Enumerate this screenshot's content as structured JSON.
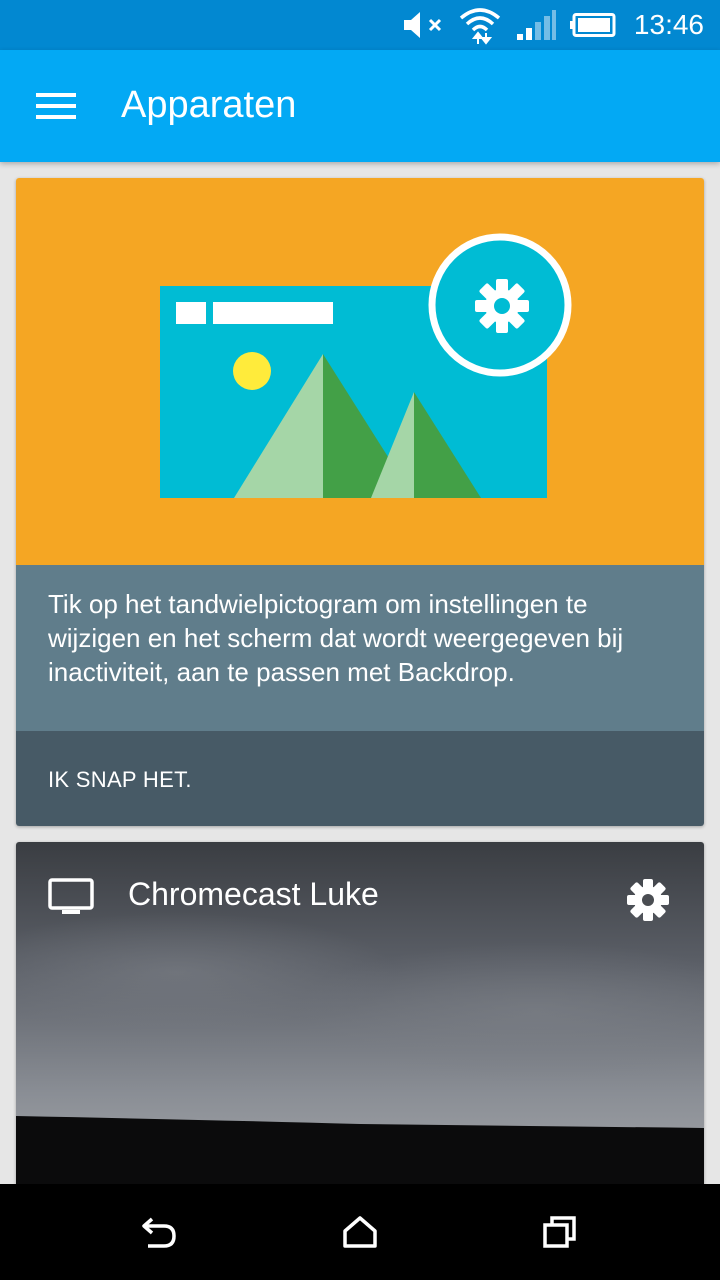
{
  "status_bar": {
    "time": "13:46",
    "icons": [
      "volume-muted-icon",
      "wifi-icon",
      "signal-icon",
      "battery-icon"
    ]
  },
  "app_bar": {
    "title": "Apparaten",
    "menu_icon": "hamburger-menu-icon"
  },
  "onboarding_card": {
    "illustration": "backdrop-settings-illustration",
    "message": "Tik op het tandwielpictogram om instellingen te wijzigen en het scherm dat wordt weergegeven bij inactiviteit, aan te passen met Backdrop.",
    "action_label": "IK SNAP HET."
  },
  "device_card": {
    "device_icon": "tv-icon",
    "device_name": "Chromecast Luke",
    "settings_icon": "gear-icon"
  },
  "nav_bar": {
    "icons": [
      "back-icon",
      "home-icon",
      "recents-icon"
    ]
  },
  "colors": {
    "status_bar": "#0288d1",
    "app_bar": "#03a9f4",
    "illustration_bg": "#f5a623",
    "tip_panel": "#607d8b",
    "action_panel": "#475a66"
  }
}
